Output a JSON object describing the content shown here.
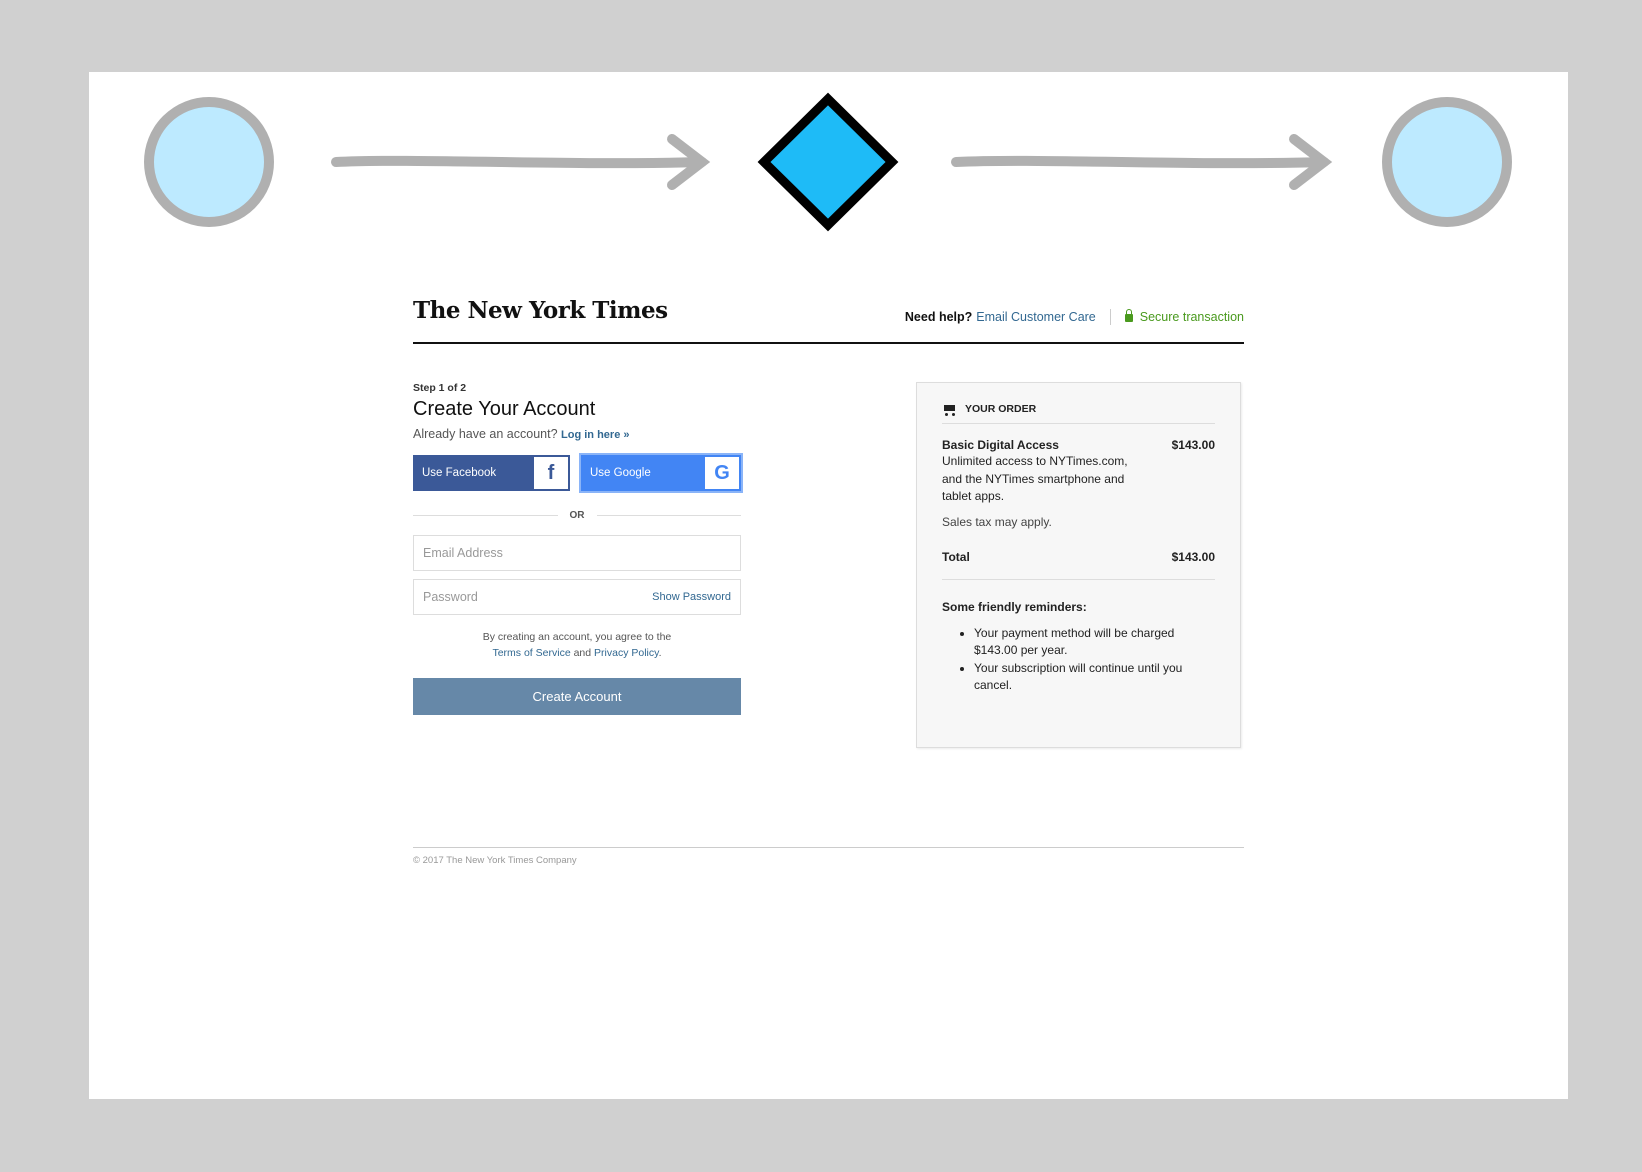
{
  "header": {
    "logo_text": "The New York Times",
    "help_label": "Need help?",
    "help_link": "Email Customer Care",
    "secure_label": "Secure transaction"
  },
  "form": {
    "step": "Step 1 of 2",
    "title": "Create Your Account",
    "already_text": "Already have an account?",
    "login_link": "Log in here »",
    "facebook_label": "Use Facebook",
    "google_label": "Use Google",
    "or_label": "OR",
    "email_placeholder": "Email Address",
    "password_placeholder": "Password",
    "show_password": "Show Password",
    "terms_prefix": "By creating an account, you agree to the",
    "terms_link": "Terms of Service",
    "terms_and": "and",
    "privacy_link": "Privacy Policy",
    "terms_suffix": ".",
    "create_button": "Create Account"
  },
  "order": {
    "heading": "YOUR ORDER",
    "item_name": "Basic Digital Access",
    "item_price": "$143.00",
    "item_desc": "Unlimited access to NYTimes.com, and the NYTimes smartphone and tablet apps.",
    "tax_note": "Sales tax may apply.",
    "total_label": "Total",
    "total_price": "$143.00",
    "reminders_title": "Some friendly reminders:",
    "reminders": [
      "Your payment method will be charged $143.00 per year.",
      "Your subscription will continue until you cancel."
    ]
  },
  "footer": {
    "copyright": "© 2017 The New York Times Company"
  },
  "colors": {
    "circle_fill": "#bdeaff",
    "circle_stroke": "#b0b0b0",
    "diamond_fill": "#1ebbf7",
    "arrow": "#b0b0b0",
    "link": "#326891",
    "secure": "#4a9a1e",
    "facebook": "#3b5998",
    "google": "#4285f4",
    "create_button": "#6688a8"
  }
}
